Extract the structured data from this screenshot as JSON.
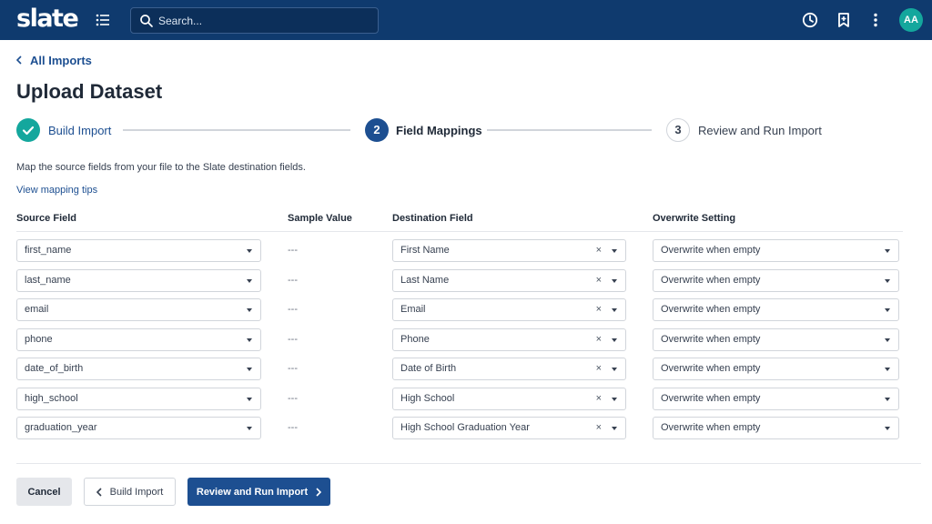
{
  "header": {
    "logo": "slate",
    "search_placeholder": "Search...",
    "avatar_initials": "AA"
  },
  "breadcrumb": {
    "label": "All Imports"
  },
  "page_title": "Upload Dataset",
  "steps": [
    {
      "number": "1",
      "label": "Build Import",
      "state": "complete"
    },
    {
      "number": "2",
      "label": "Field Mappings",
      "state": "active"
    },
    {
      "number": "3",
      "label": "Review and Run Import",
      "state": "pending"
    }
  ],
  "instructions": "Map the source fields from your file to the Slate destination fields.",
  "tips_link": "View mapping tips",
  "columns": {
    "source": "Source Field",
    "sample": "Sample Value",
    "destination": "Destination Field",
    "overwrite": "Overwrite Setting"
  },
  "rows": [
    {
      "source": "first_name",
      "sample": "---",
      "destination": "First Name",
      "overwrite": "Overwrite when empty"
    },
    {
      "source": "last_name",
      "sample": "---",
      "destination": "Last Name",
      "overwrite": "Overwrite when empty"
    },
    {
      "source": "email",
      "sample": "---",
      "destination": "Email",
      "overwrite": "Overwrite when empty"
    },
    {
      "source": "phone",
      "sample": "---",
      "destination": "Phone",
      "overwrite": "Overwrite when empty"
    },
    {
      "source": "date_of_birth",
      "sample": "---",
      "destination": "Date of Birth",
      "overwrite": "Overwrite when empty"
    },
    {
      "source": "high_school",
      "sample": "---",
      "destination": "High School",
      "overwrite": "Overwrite when empty"
    },
    {
      "source": "graduation_year",
      "sample": "---",
      "destination": "High School Graduation Year",
      "overwrite": "Overwrite when empty"
    }
  ],
  "clear_symbol": "×",
  "buttons": {
    "cancel": "Cancel",
    "back": "Build Import",
    "next": "Review and Run Import"
  },
  "colors": {
    "header_bg": "#0f3a6e",
    "primary": "#1d4f91",
    "step_complete": "#14a79d",
    "avatar_bg": "#14a79d"
  },
  "icons": [
    "menu-icon",
    "search-icon",
    "history-clock-icon",
    "bookmark-icon",
    "more-vertical-icon",
    "check-icon",
    "chevron-left-icon",
    "chevron-right-icon",
    "chevron-down-icon",
    "clear-icon"
  ]
}
